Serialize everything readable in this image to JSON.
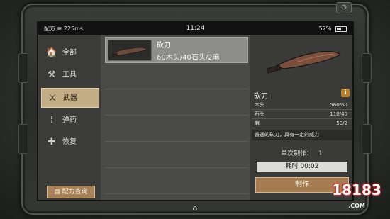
{
  "status_bar": {
    "carrier": "配方",
    "speed": "225ms",
    "time": "11:24",
    "battery": "52%"
  },
  "menu": {
    "items": [
      {
        "label": "全部",
        "icon": "building-icon",
        "glyph": "🏠"
      },
      {
        "label": "工具",
        "icon": "crossed-tools-icon",
        "glyph": "⚒"
      },
      {
        "label": "武器",
        "icon": "crossed-blades-icon",
        "glyph": "⚔"
      },
      {
        "label": "弹药",
        "icon": "ammo-icon",
        "glyph": "⁞"
      },
      {
        "label": "恢复",
        "icon": "bandage-icon",
        "glyph": "✚"
      }
    ],
    "active_index": 2,
    "recipe_query": {
      "label": "配方查询",
      "icon": "book-icon"
    }
  },
  "recipe_list": {
    "selected": {
      "name": "砍刀",
      "cost": "60木头/40石头/2麻"
    }
  },
  "detail": {
    "name": "砍刀",
    "info_label": "i",
    "materials": [
      {
        "name": "木头",
        "value": "560/60"
      },
      {
        "name": "石头",
        "value": "110/40"
      },
      {
        "name": "麻",
        "value": "50/2"
      }
    ],
    "description": "普通的砍刀，具有一定的威力",
    "qty_label": "单次制作：",
    "qty_value": "1",
    "time_label": "耗时 00:02",
    "make_label": "制作"
  },
  "device": {
    "corner_button_icon": "power-icon",
    "home_icon": "home-icon"
  },
  "watermark": {
    "brand": "18183",
    "domain": ".COM"
  },
  "colors": {
    "accent_tan": "#c3ad84",
    "button_brown": "#a57c52",
    "info_orange": "#b8802a"
  }
}
